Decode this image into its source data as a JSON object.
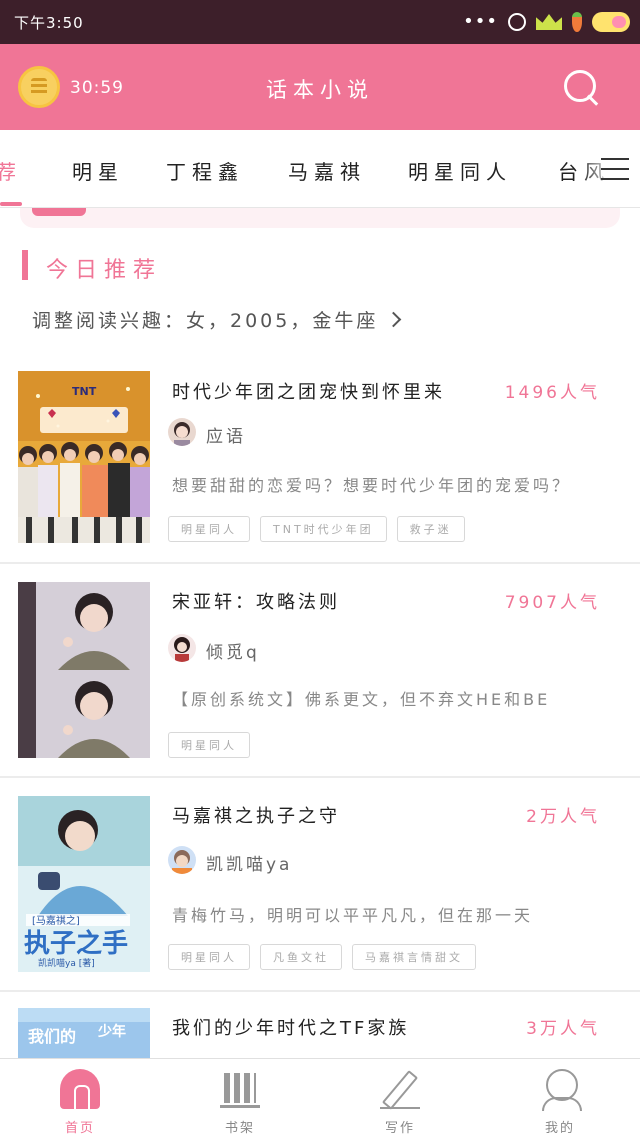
{
  "status_bar": {
    "time": "下午3:50",
    "icons": [
      "more-dots-icon",
      "alarm-icon",
      "crown-icon",
      "carrot-icon",
      "cloud-icon"
    ]
  },
  "header": {
    "timer": "30:59",
    "title": "话本小说",
    "timer_icon": "timer-coin-icon",
    "search_icon": "search-icon"
  },
  "tabs": [
    {
      "label": "荐",
      "active": true
    },
    {
      "label": "明星",
      "active": false
    },
    {
      "label": "丁程鑫",
      "active": false
    },
    {
      "label": "马嘉祺",
      "active": false
    },
    {
      "label": "明星同人",
      "active": false
    },
    {
      "label": "台风",
      "active": false
    }
  ],
  "section": {
    "title": "今日推荐",
    "interest": "调整阅读兴趣：女，2005，金牛座"
  },
  "books": [
    {
      "title": "时代少年团之团宠快到怀里来",
      "popularity": "1496人气",
      "author": "应语",
      "description": "想要甜甜的恋爱吗？想要时代少年团的宠爱吗？",
      "tags": [
        "明星同人",
        "TNT时代少年团",
        "救子迷"
      ]
    },
    {
      "title": "宋亚轩：攻略法则",
      "popularity": "7907人气",
      "author": "倾觅q",
      "description": "【原创系统文】佛系更文，但不弃文HE和BE",
      "tags": [
        "明星同人"
      ]
    },
    {
      "title": "马嘉祺之执子之守",
      "popularity": "2万人气",
      "author": "凯凯喵ya",
      "description": "青梅竹马，明明可以平平凡凡，但在那一天",
      "tags": [
        "明星同人",
        "凡鱼文社",
        "马嘉祺言情甜文"
      ]
    },
    {
      "title": "我们的少年时代之TF家族",
      "popularity": "3万人气"
    }
  ],
  "bottom_nav": [
    {
      "label": "首页",
      "icon": "home-icon",
      "active": true
    },
    {
      "label": "书架",
      "icon": "bookshelf-icon",
      "active": false
    },
    {
      "label": "写作",
      "icon": "pen-icon",
      "active": false
    },
    {
      "label": "我的",
      "icon": "profile-icon",
      "active": false
    }
  ],
  "colors": {
    "accent": "#f07596",
    "status_bar": "#3d1f2a"
  }
}
